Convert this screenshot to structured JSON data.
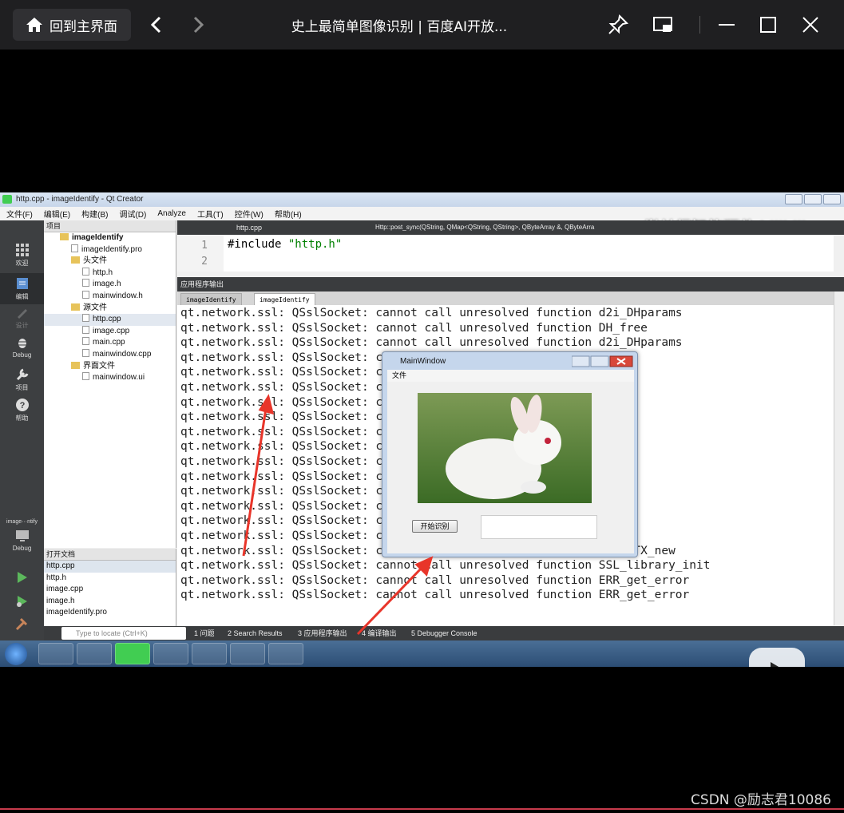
{
  "player": {
    "home_label": "回到主界面",
    "title": "史上最简单图像识别 | 百度AI开放..."
  },
  "qt": {
    "window_title": "http.cpp - imageIdentify - Qt Creator",
    "menu": [
      "文件(F)",
      "编辑(E)",
      "构建(B)",
      "调试(D)",
      "Analyze",
      "工具(T)",
      "控件(W)",
      "帮助(H)"
    ],
    "watermark": "学益得智能硬件 bilibili",
    "sidebar": [
      "欢迎",
      "编辑",
      "设计",
      "Debug",
      "项目",
      "帮助"
    ],
    "kit_label": "image···ntify",
    "kit_mode": "Debug",
    "project_header": "项目",
    "tree": [
      {
        "label": "imageIdentify",
        "indent": 1,
        "type": "folder",
        "bold": true
      },
      {
        "label": "imageIdentify.pro",
        "indent": 2,
        "type": "file"
      },
      {
        "label": "头文件",
        "indent": 2,
        "type": "folder"
      },
      {
        "label": "http.h",
        "indent": 3,
        "type": "file"
      },
      {
        "label": "image.h",
        "indent": 3,
        "type": "file"
      },
      {
        "label": "mainwindow.h",
        "indent": 3,
        "type": "file"
      },
      {
        "label": "源文件",
        "indent": 2,
        "type": "folder"
      },
      {
        "label": "http.cpp",
        "indent": 3,
        "type": "file",
        "selected": true
      },
      {
        "label": "image.cpp",
        "indent": 3,
        "type": "file"
      },
      {
        "label": "main.cpp",
        "indent": 3,
        "type": "file"
      },
      {
        "label": "mainwindow.cpp",
        "indent": 3,
        "type": "file"
      },
      {
        "label": "界面文件",
        "indent": 2,
        "type": "folder"
      },
      {
        "label": "mainwindow.ui",
        "indent": 3,
        "type": "file"
      }
    ],
    "open_docs_header": "打开文档",
    "open_docs": [
      "http.cpp",
      "http.h",
      "image.cpp",
      "image.h",
      "imageIdentify.pro"
    ],
    "editor_tab": "http.cpp",
    "editor_func": "Http::post_sync(QString, QMap<QString, QString>, QByteArray &, QByteArra",
    "code_lines": [
      {
        "no": "1",
        "prefix": "#include ",
        "str": "\"http.h\""
      },
      {
        "no": "2",
        "prefix": "",
        "str": ""
      }
    ],
    "output_header": "应用程序输出",
    "output_tabs": [
      "imageIdentify",
      "imageIdentify"
    ],
    "log": [
      "qt.network.ssl: QSslSocket: cannot call unresolved function d2i_DHparams",
      "qt.network.ssl: QSslSocket: cannot call unresolved function DH_free",
      "qt.network.ssl: QSslSocket: cannot call unresolved function d2i_DHparams",
      "qt.network.ssl: QSslSocket: ca                                     arams",
      "qt.network.ssl: QSslSocket: ca",
      "qt.network.ssl: QSslSocket: ca                                     arams",
      "qt.network.ssl: QSslSocket: ca",
      "qt.network.ssl: QSslSocket: ca                                     arams",
      "qt.network.ssl: QSslSocket: ca",
      "qt.network.ssl: QSslSocket: ca                                     arams",
      "qt.network.ssl: QSslSocket: ca",
      "qt.network.ssl: QSslSocket: ca                                     arams",
      "qt.network.ssl: QSslSocket: ca",
      "qt.network.ssl: QSslSocket: ca                                     arams",
      "qt.network.ssl: QSslSocket: ca",
      "qt.network.ssl: QSslSocket: ca                                     client_method",
      "qt.network.ssl: QSslSocket: cannot call unresolved function SSL_CTX_new",
      "qt.network.ssl: QSslSocket: cannot call unresolved function SSL_library_init",
      "qt.network.ssl: QSslSocket: cannot call unresolved function ERR_get_error",
      "qt.network.ssl: QSslSocket: cannot call unresolved function ERR_get_error"
    ],
    "locate_placeholder": "Type to locate (Ctrl+K)",
    "bottom_tabs": [
      "1 问题",
      "2 Search Results",
      "3 应用程序输出",
      "4 编译输出",
      "5 Debugger Console"
    ]
  },
  "dialog": {
    "title": "MainWindow",
    "menu": "文件",
    "button": "开始识别",
    "result": ""
  },
  "footer": {
    "credit": "CSDN @励志君10086"
  },
  "colors": {
    "arrow": "#e8352a",
    "qt_dark": "#3d3f41"
  }
}
